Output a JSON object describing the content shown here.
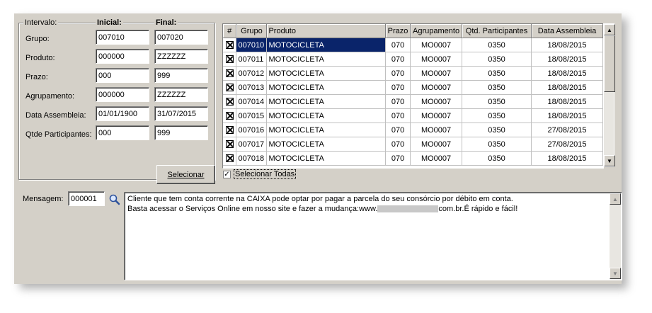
{
  "filter": {
    "title_intervalo": "Intervalo:",
    "title_inicial": "Inicial:",
    "title_final": "Final:",
    "rows": [
      {
        "label": "Grupo:",
        "inicial": "007010",
        "final": "007020"
      },
      {
        "label": "Produto:",
        "inicial": "000000",
        "final": "ZZZZZZ"
      },
      {
        "label": "Prazo:",
        "inicial": "000",
        "final": "999"
      },
      {
        "label": "Agrupamento:",
        "inicial": "000000",
        "final": "ZZZZZZ"
      },
      {
        "label": "Data Assembleia:",
        "inicial": "01/01/1900",
        "final": "31/07/2015"
      },
      {
        "label": "Qtde Participantes:",
        "inicial": "000",
        "final": "999"
      }
    ],
    "select_button": "Selecionar"
  },
  "grid": {
    "columns": [
      "#",
      "Grupo",
      "Produto",
      "Prazo",
      "Agrupamento",
      "Qtd. Participantes",
      "Data Assembleia"
    ],
    "rows": [
      [
        "007010",
        "MOTOCICLETA",
        "070",
        "MO0007",
        "0350",
        "18/08/2015"
      ],
      [
        "007011",
        "MOTOCICLETA",
        "070",
        "MO0007",
        "0350",
        "18/08/2015"
      ],
      [
        "007012",
        "MOTOCICLETA",
        "070",
        "MO0007",
        "0350",
        "18/08/2015"
      ],
      [
        "007013",
        "MOTOCICLETA",
        "070",
        "MO0007",
        "0350",
        "18/08/2015"
      ],
      [
        "007014",
        "MOTOCICLETA",
        "070",
        "MO0007",
        "0350",
        "18/08/2015"
      ],
      [
        "007015",
        "MOTOCICLETA",
        "070",
        "MO0007",
        "0350",
        "18/08/2015"
      ],
      [
        "007016",
        "MOTOCICLETA",
        "070",
        "MO0007",
        "0350",
        "27/08/2015"
      ],
      [
        "007017",
        "MOTOCICLETA",
        "070",
        "MO0007",
        "0350",
        "27/08/2015"
      ],
      [
        "007018",
        "MOTOCICLETA",
        "070",
        "MO0007",
        "0350",
        "18/08/2015"
      ]
    ],
    "selected_row": 0,
    "select_all_label": "Selecionar Todas"
  },
  "message": {
    "label": "Mensagem:",
    "code": "000001",
    "line1": "Cliente que tem conta corrente na CAIXA pode optar por pagar a parcela do seu consórcio por débito em conta.",
    "line2_prefix": "Basta acessar o Serviços Online em nosso site e fazer a mudança:www.",
    "line2_suffix": "com.br.É rápido e fácil!"
  },
  "colors": {
    "selection": "#0a246a",
    "window": "#d4d0c8"
  }
}
